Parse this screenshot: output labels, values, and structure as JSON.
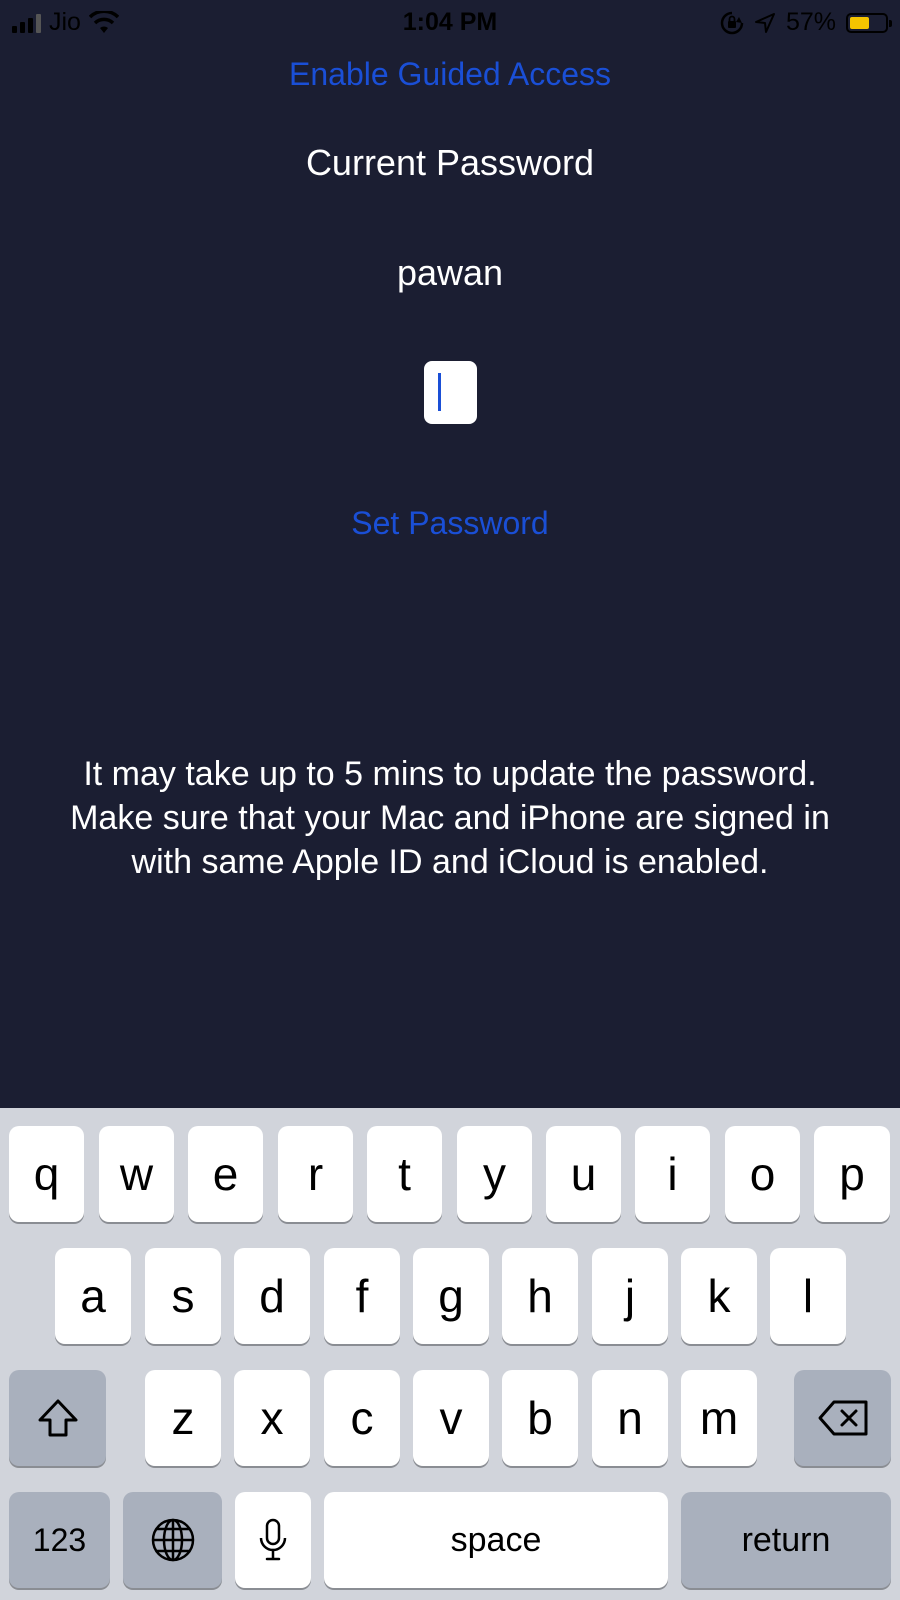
{
  "status_bar": {
    "carrier": "Jio",
    "time": "1:04 PM",
    "battery_percent": "57%",
    "battery_level": 0.57,
    "battery_color": "#f5c400",
    "icons": [
      "signal-icon",
      "wifi-icon",
      "rotation-lock-icon",
      "location-arrow-icon",
      "battery-icon"
    ]
  },
  "main": {
    "guided_access_link": "Enable Guided Access",
    "heading": "Current Password",
    "current_password": "pawan",
    "set_password_link": "Set Password",
    "info_lines": [
      "It may take up to 5 mins to update the password.",
      "Make sure that your Mac and iPhone are signed in",
      "with same Apple ID and iCloud is enabled."
    ]
  },
  "colors": {
    "background": "#1b1e32",
    "link": "#1a4fd6",
    "keyboard_bg": "#d1d4db"
  },
  "keyboard": {
    "row1": [
      "q",
      "w",
      "e",
      "r",
      "t",
      "y",
      "u",
      "i",
      "o",
      "p"
    ],
    "row2": [
      "a",
      "s",
      "d",
      "f",
      "g",
      "h",
      "j",
      "k",
      "l"
    ],
    "row3": [
      "z",
      "x",
      "c",
      "v",
      "b",
      "n",
      "m"
    ],
    "numbers_key": "123",
    "space_key": "space",
    "return_key": "return",
    "icons": [
      "shift-icon",
      "delete-icon",
      "globe-icon",
      "microphone-icon"
    ]
  }
}
